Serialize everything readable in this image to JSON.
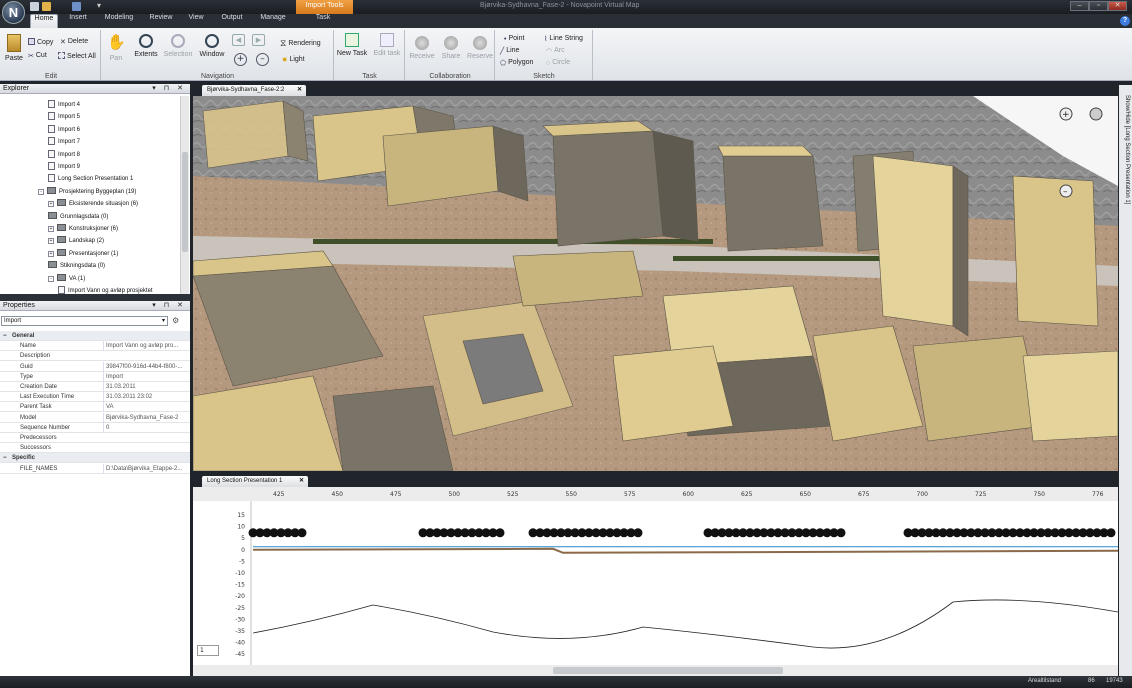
{
  "title_bar": {
    "app_letter": "N",
    "context_tab": "Import Tools",
    "window_title": "Bjørvika-Sydhavna_Fase-2 - Novapoint Virtual Map",
    "buttons": [
      "–",
      "▫",
      "✕"
    ]
  },
  "ribbon_tabs": [
    {
      "label": "Home",
      "active": true
    },
    {
      "label": "Insert"
    },
    {
      "label": "Modeling"
    },
    {
      "label": "Review"
    },
    {
      "label": "View"
    },
    {
      "label": "Output"
    },
    {
      "label": "Manage"
    },
    {
      "label": "Task"
    }
  ],
  "ribbon": {
    "edit": {
      "label": "Edit",
      "paste": "Paste",
      "copy": "Copy",
      "cut": "Cut",
      "delete": "Delete",
      "select_all": "Select All"
    },
    "navigation": {
      "label": "Navigation",
      "pan": "Pan",
      "extents": "Extents",
      "selection": "Selection",
      "window": "Window",
      "rendering": "Rendering",
      "light": "Light"
    },
    "task": {
      "label": "Task",
      "new_task": "New Task",
      "edit_task": "Edit task"
    },
    "collaboration": {
      "label": "Collaboration",
      "receive_1": "Receive",
      "share": "Share",
      "receive_2": "Reserve"
    },
    "sketch": {
      "label": "Sketch",
      "point": "Point",
      "line_string": "Line String",
      "line": "Line",
      "arc": "Arc",
      "polygon": "Polygon",
      "circle": "Circle"
    }
  },
  "explorer": {
    "title": "Explorer",
    "items": [
      {
        "label": "Import 4",
        "level": 3
      },
      {
        "label": "Import 5",
        "level": 3
      },
      {
        "label": "Import 6",
        "level": 3
      },
      {
        "label": "Import 7",
        "level": 3
      },
      {
        "label": "Import 8",
        "level": 3
      },
      {
        "label": "Import 9",
        "level": 3
      },
      {
        "label": "Long Section Presentation 1",
        "level": 3
      },
      {
        "label": "Prosjektering Byggeplan (19)",
        "level": 2,
        "folder": true,
        "toggle": "-"
      },
      {
        "label": "Eksisterende situasjon (6)",
        "level": 3,
        "folder": true,
        "toggle": "+"
      },
      {
        "label": "Grunnlagsdata (0)",
        "level": 3,
        "folder": true
      },
      {
        "label": "Konstruksjoner (6)",
        "level": 3,
        "folder": true,
        "toggle": "+"
      },
      {
        "label": "Landskap (2)",
        "level": 3,
        "folder": true,
        "toggle": "+"
      },
      {
        "label": "Presentasjoner (1)",
        "level": 3,
        "folder": true,
        "toggle": "+"
      },
      {
        "label": "Stikningsdata (0)",
        "level": 3,
        "folder": true
      },
      {
        "label": "VA (1)",
        "level": 3,
        "folder": true,
        "toggle": "-"
      },
      {
        "label": "Import Vann og avløp prosjektet",
        "level": 4
      }
    ]
  },
  "properties": {
    "title": "Properties",
    "combo": "Import",
    "rows": [
      {
        "key": "General",
        "cat": true
      },
      {
        "key": "Name",
        "value": "Import Vann og avløp pro..."
      },
      {
        "key": "Description",
        "value": ""
      },
      {
        "key": "Guid",
        "value": "39847f00-916d-44b4-f800-..."
      },
      {
        "key": "Type",
        "value": "Import"
      },
      {
        "key": "Creation Date",
        "value": "31.03.2011"
      },
      {
        "key": "Last Execution Time",
        "value": "31.03.2011 23:02"
      },
      {
        "key": "Parent Task",
        "value": "VA"
      },
      {
        "key": "Model",
        "value": "Bjørvika-Sydhavna_Fase-2"
      },
      {
        "key": "Sequence Number",
        "value": "0"
      },
      {
        "key": "Predecessors",
        "value": ""
      },
      {
        "key": "Successors",
        "value": ""
      },
      {
        "key": "Specific",
        "cat": true
      },
      {
        "key": "FILE_NAMES",
        "value": "D:\\Data\\Bjørvika_Etappe-2..."
      }
    ]
  },
  "viewport": {
    "tab": "Bjørvika-Sydhavna_Fase-2:2"
  },
  "long_section": {
    "tab": "Long Section Presentation 1",
    "x_ticks": [
      "425",
      "450",
      "475",
      "500",
      "525",
      "550",
      "575",
      "600",
      "625",
      "650",
      "675",
      "700",
      "725",
      "750",
      "776"
    ],
    "y_ticks": [
      "15",
      "10",
      "5",
      "0",
      "-5",
      "-10",
      "-15",
      "-20",
      "-25",
      "-30",
      "-35",
      "-40",
      "-45"
    ],
    "spinner": "1"
  },
  "side_panel": {
    "label": "Show/Hide [Long Section Presentation 1]"
  },
  "status": {
    "layer": "Arealtilstand",
    "zoom": "86",
    "count": "19743"
  },
  "colors": {
    "accent_orange": "#e08a2a",
    "ribbon": "#e6e9ed",
    "building": "#d9c48a"
  }
}
